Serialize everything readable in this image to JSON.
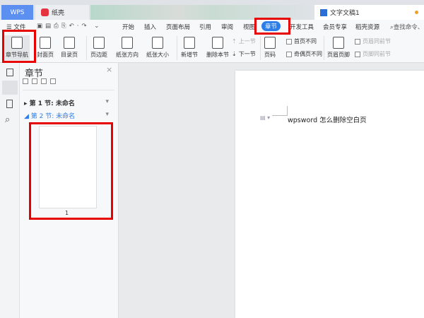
{
  "tabs": {
    "wps": "WPS",
    "zhike": "纸壳",
    "doc": "文字文稿1"
  },
  "menu": {
    "file": "文件",
    "items": [
      "开始",
      "插入",
      "页面布局",
      "引用",
      "审阅",
      "视图",
      "章节",
      "开发工具",
      "会员专享",
      "稻壳资源"
    ],
    "active": "章节",
    "search": "查找命令、"
  },
  "ribbon": {
    "section_nav": "章节导航",
    "cover": "封面页",
    "toc": "目录页",
    "margins": "页边距",
    "orientation": "纸张方向",
    "size": "纸张大小",
    "new_section": "新增节",
    "delete_section": "删除本节",
    "prev_section": "上一节",
    "next_section": "下一节",
    "page_number": "页码",
    "first_diff": "首页不同",
    "odd_even_diff": "奇偶页不同",
    "header_footer": "页眉页脚",
    "header_same": "页眉同前节",
    "footer_same": "页脚同前节"
  },
  "panel": {
    "title": "章节",
    "sections": [
      {
        "label": "第 1 节: 未命名"
      },
      {
        "label": "第 2 节: 未命名"
      }
    ],
    "page_number": "1"
  },
  "document": {
    "text": "wpsword 怎么删除空白页"
  },
  "colors": {
    "accent": "#2b7de9",
    "highlight": "#e60000"
  }
}
